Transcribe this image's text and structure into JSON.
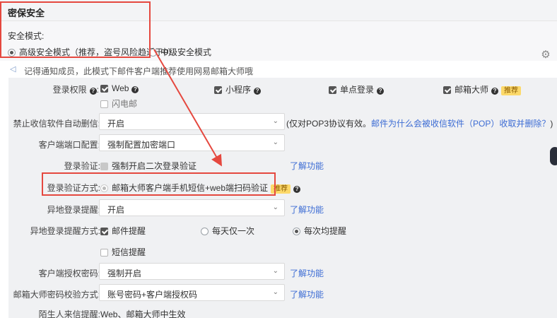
{
  "header": {
    "title": "密保安全"
  },
  "mode": {
    "label": "安全模式:",
    "options": [
      "高级安全模式（推荐，盗号风险趋近于0）",
      "中级安全模式"
    ]
  },
  "notice": "记得通知成员，此模式下邮件客户端推荐使用网易邮箱大师哦",
  "login_perm": {
    "label": "登录权限",
    "options": [
      "Web",
      "小程序",
      "单点登录",
      "邮箱大师",
      "闪电邮"
    ],
    "recommend": "推荐"
  },
  "forbid_delete": {
    "label": "禁止收信软件自动删信:",
    "value": "开启",
    "note": "(仅对POP3协议有效。",
    "link": "邮件为什么会被收信软件（POP）收取并删除？",
    "note_end": ")"
  },
  "client_port": {
    "label": "客户端端口配置:",
    "value": "强制配置加密端口"
  },
  "login_verify": {
    "label": "登录验证:",
    "option": "强制开启二次登录验证",
    "link": "了解功能"
  },
  "verify_method": {
    "label": "登录验证方式:",
    "option": "邮箱大师客户端手机短信+web端扫码验证",
    "recommend": "推荐"
  },
  "remote_alert": {
    "label": "异地登录提醒:",
    "value": "开启",
    "link": "了解功能"
  },
  "remote_method": {
    "label": "异地登录提醒方式:",
    "mail": "邮件提醒",
    "daily_once": "每天仅一次",
    "every_time": "每次均提醒",
    "sms": "短信提醒"
  },
  "client_auth": {
    "label": "客户端授权密码:",
    "value": "强制开启",
    "link": "了解功能"
  },
  "master_verify": {
    "label": "邮箱大师密码校验方式:",
    "value": "账号密码+客户端授权码",
    "link": "了解功能"
  },
  "stranger": {
    "label": "陌生人来信提醒:",
    "value": "Web、邮箱大师中生效"
  }
}
